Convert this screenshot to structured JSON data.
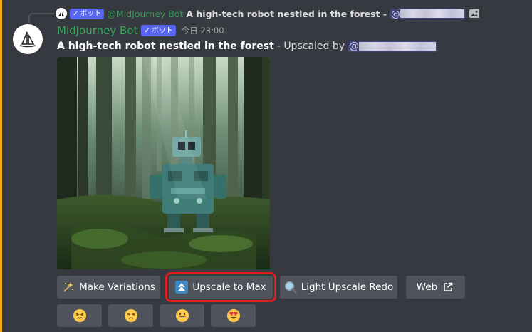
{
  "reply": {
    "badge_label": "ボット",
    "author": "@MidJourney Bot",
    "text": "A high-tech robot nestled in the forest -",
    "mention_prefix": "@",
    "attachment_icon": "image-icon"
  },
  "message": {
    "author": "MidJourney Bot",
    "badge_label": "ボット",
    "timestamp": "今日 23:00",
    "title": "A high-tech robot nestled in the forest",
    "suffix": "- Upscaled by",
    "mention_prefix": "@",
    "avatar_icon": "sailboat-icon"
  },
  "image": {
    "icon": "forest-robot-artwork"
  },
  "buttons": [
    {
      "label": "Make Variations",
      "icon": "magic-wand-icon"
    },
    {
      "label": "Upscale to Max",
      "icon": "upscale-arrow-icon"
    },
    {
      "label": "Light Upscale Redo",
      "icon": "magnifier-icon"
    },
    {
      "label": "Web",
      "icon": "external-link-icon"
    }
  ],
  "reactions": [
    {
      "icon": "confounded-face-emoji"
    },
    {
      "icon": "unamused-face-emoji"
    },
    {
      "icon": "grinning-face-emoji"
    },
    {
      "icon": "heart-eyes-emoji"
    }
  ],
  "colors": {
    "background": "#36393f",
    "accent_bar": "#faa81a",
    "bot_name": "#3ba55d",
    "badge": "#5865f2",
    "button": "#4f545c",
    "highlight": "#e01e1e"
  }
}
